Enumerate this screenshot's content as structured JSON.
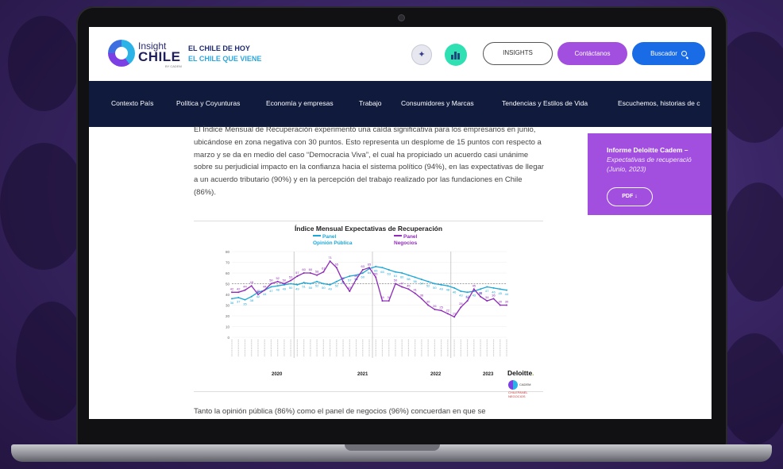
{
  "header": {
    "logo_insight": "Insight",
    "logo_chile": "CHILE",
    "logo_sub": "BY CADEM",
    "tagline_1": "EL CHILE DE HOY",
    "tagline_2": "EL CHILE QUE VIENE",
    "insights_label": "INSIGHTS",
    "contact_label": "Contáctanos",
    "search_label": "Buscador",
    "colors": {
      "contact": "#a24fe0",
      "search": "#1a6be6",
      "nav_bg": "#0f1a3c"
    }
  },
  "nav": {
    "items": [
      "Contexto País",
      "Política y Coyunturas",
      "Economía y empresas",
      "Trabajo",
      "Consumidores y Marcas",
      "Tendencias y Estilos de Vida",
      "Escuchemos, historias de c"
    ]
  },
  "article": {
    "paragraph_1": "El Índice Mensual de Recuperación experimentó una caída significativa para los empresarios en junio, ubicándose en zona negativa con 30 puntos. Esto representa un desplome de 15 puntos con respecto a marzo y se da en medio del caso “Democracia Viva”, el cual ha propiciado un acuerdo casi unánime sobre su perjudicial impacto en la confianza hacia el sistema político (94%), en las expectativas de llegar a un acuerdo tributario (90%) y en la percepción del trabajo realizado por las fundaciones en Chile (86%).",
    "paragraph_2": "Tanto la opinión pública (86%) como el panel de negocios (96%) concuerdan en que se"
  },
  "figure": {
    "deloitte": "Deloitte",
    "deloitte_dot": ".",
    "cadem": "CADEM",
    "cadem_sub": "CHILEPANEL NEGOCIOS"
  },
  "chart_data": {
    "type": "line",
    "title": "Índice Mensual Expectativas de Recuperación",
    "ylim": [
      0,
      80
    ],
    "yticks": [
      0,
      10,
      20,
      30,
      40,
      50,
      60,
      70,
      80
    ],
    "year_labels": [
      "2020",
      "2021",
      "2022",
      "2023"
    ],
    "series": [
      {
        "name": "Panel Opinión Pública",
        "legend_line1": "Panel",
        "legend_line2": "Opinión Pública",
        "color": "#1ea7d6",
        "values": [
          36,
          37,
          35,
          38,
          42,
          44,
          47,
          48,
          49,
          50,
          49,
          51,
          50,
          52,
          50,
          49,
          52,
          55,
          57,
          58,
          60,
          64,
          66,
          65,
          63,
          61,
          60,
          58,
          56,
          54,
          52,
          50,
          49,
          48,
          46,
          43,
          42,
          43,
          45,
          47,
          46,
          45,
          44
        ]
      },
      {
        "name": "Panel Negocios",
        "legend_line1": "Panel",
        "legend_line2": "Negocios",
        "color": "#8e2bb8",
        "values": [
          42,
          42,
          44,
          48,
          40,
          44,
          50,
          52,
          50,
          53,
          57,
          60,
          60,
          58,
          61,
          71,
          65,
          52,
          43,
          54,
          63,
          65,
          56,
          34,
          34,
          50,
          47,
          45,
          41,
          36,
          30,
          26,
          25,
          22,
          19,
          28,
          34,
          45,
          38,
          34,
          36,
          30,
          30
        ]
      }
    ]
  },
  "sidebar": {
    "card_title": "Informe Deloitte Cadem –",
    "card_sub_1": "Expectativas de recuperació",
    "card_sub_2": "(Junio, 2023)",
    "pdf_label": "PDF ↓"
  }
}
